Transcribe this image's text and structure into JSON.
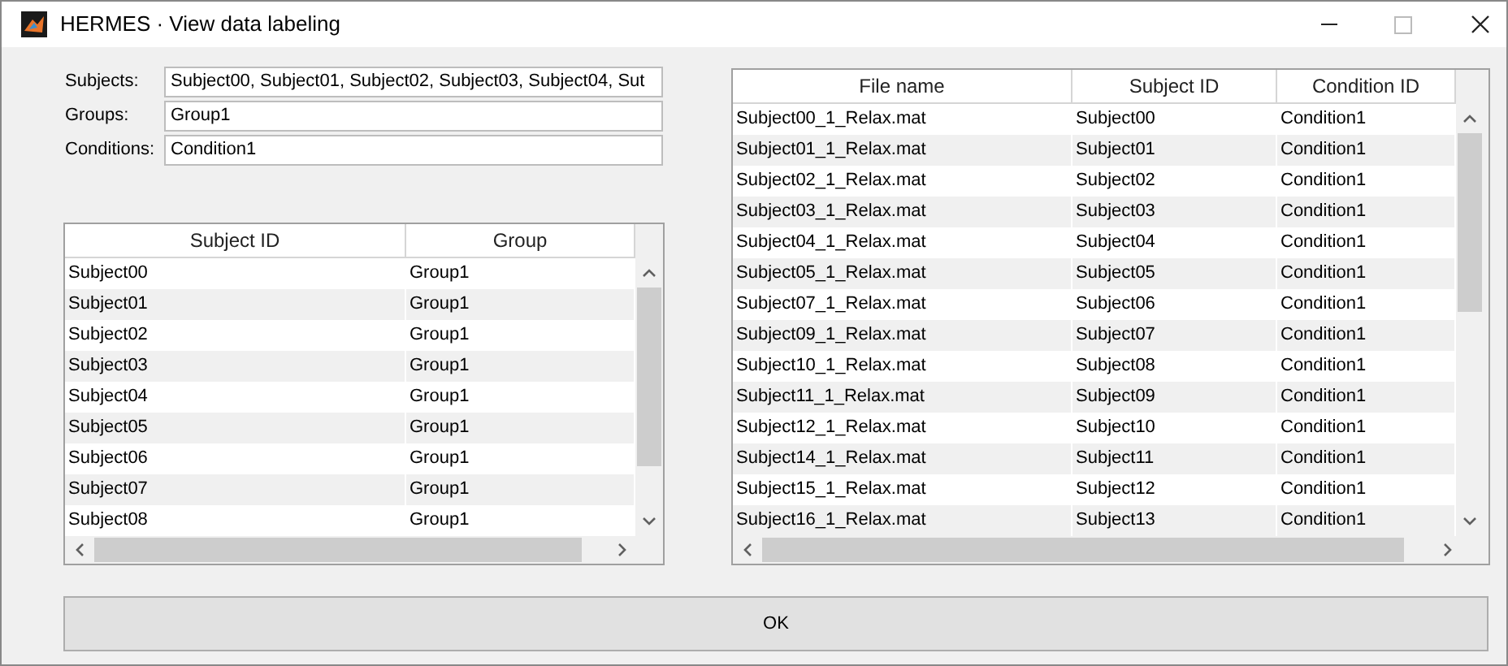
{
  "window": {
    "title": "HERMES · View data labeling"
  },
  "fields": [
    {
      "label": "Subjects:",
      "value": "Subject00, Subject01, Subject02, Subject03, Subject04, Sut"
    },
    {
      "label": "Groups:",
      "value": "Group1"
    },
    {
      "label": "Conditions:",
      "value": "Condition1"
    }
  ],
  "subjects_table": {
    "columns": [
      "Subject ID",
      "Group"
    ],
    "rows": [
      [
        "Subject00",
        "Group1"
      ],
      [
        "Subject01",
        "Group1"
      ],
      [
        "Subject02",
        "Group1"
      ],
      [
        "Subject03",
        "Group1"
      ],
      [
        "Subject04",
        "Group1"
      ],
      [
        "Subject05",
        "Group1"
      ],
      [
        "Subject06",
        "Group1"
      ],
      [
        "Subject07",
        "Group1"
      ],
      [
        "Subject08",
        "Group1"
      ]
    ]
  },
  "files_table": {
    "columns": [
      "File name",
      "Subject ID",
      "Condition ID"
    ],
    "rows": [
      [
        "Subject00_1_Relax.mat",
        "Subject00",
        "Condition1"
      ],
      [
        "Subject01_1_Relax.mat",
        "Subject01",
        "Condition1"
      ],
      [
        "Subject02_1_Relax.mat",
        "Subject02",
        "Condition1"
      ],
      [
        "Subject03_1_Relax.mat",
        "Subject03",
        "Condition1"
      ],
      [
        "Subject04_1_Relax.mat",
        "Subject04",
        "Condition1"
      ],
      [
        "Subject05_1_Relax.mat",
        "Subject05",
        "Condition1"
      ],
      [
        "Subject07_1_Relax.mat",
        "Subject06",
        "Condition1"
      ],
      [
        "Subject09_1_Relax.mat",
        "Subject07",
        "Condition1"
      ],
      [
        "Subject10_1_Relax.mat",
        "Subject08",
        "Condition1"
      ],
      [
        "Subject11_1_Relax.mat",
        "Subject09",
        "Condition1"
      ],
      [
        "Subject12_1_Relax.mat",
        "Subject10",
        "Condition1"
      ],
      [
        "Subject14_1_Relax.mat",
        "Subject11",
        "Condition1"
      ],
      [
        "Subject15_1_Relax.mat",
        "Subject12",
        "Condition1"
      ],
      [
        "Subject16_1_Relax.mat",
        "Subject13",
        "Condition1"
      ]
    ]
  },
  "ok_button": "OK"
}
